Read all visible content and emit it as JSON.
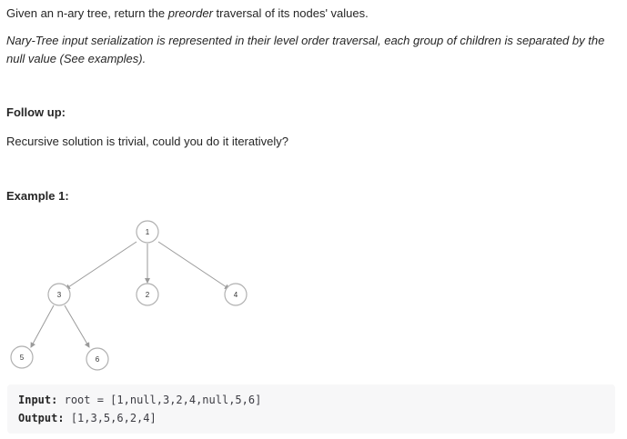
{
  "problem": {
    "intro_before": "Given an n-ary tree, return the ",
    "intro_emph": "preorder",
    "intro_after": " traversal of its nodes' values.",
    "serialization_note": "Nary-Tree input serialization is represented in their level order traversal, each group of children is separated by the null value (See examples).",
    "follow_up_heading": "Follow up:",
    "follow_up_text": "Recursive solution is trivial, could you do it iteratively?"
  },
  "example": {
    "heading": "Example 1:",
    "tree_nodes": [
      "1",
      "3",
      "2",
      "4",
      "5",
      "6"
    ],
    "input_label": "Input:",
    "input_value": "root = [1,null,3,2,4,null,5,6]",
    "output_label": "Output:",
    "output_value": "[1,3,5,6,2,4]"
  },
  "colors": {
    "text": "#262626",
    "node_border": "#b0b0b0",
    "edge": "#9a9a9a",
    "code_bg": "#f7f7f8"
  }
}
